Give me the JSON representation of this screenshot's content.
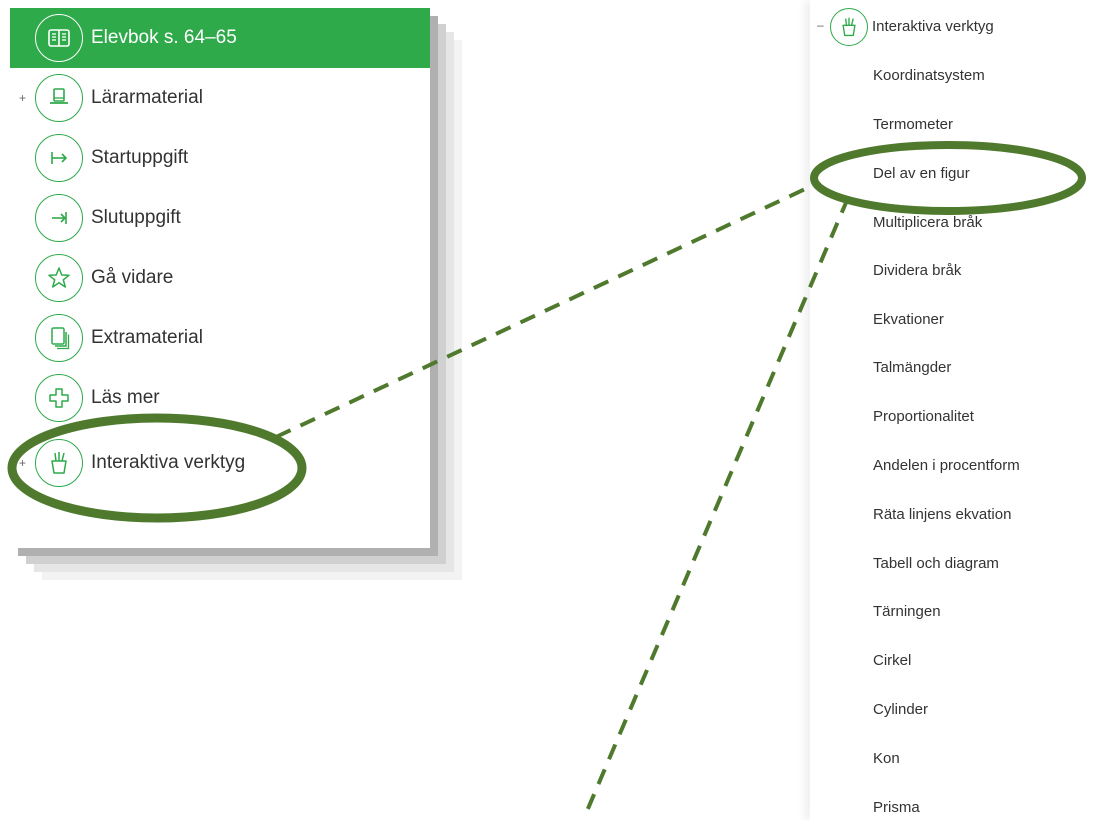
{
  "left_menu": {
    "items": [
      {
        "label": "Elevbok s. 64–65",
        "icon": "book-icon",
        "active": true,
        "expandable": false
      },
      {
        "label": "Lärarmaterial",
        "icon": "hat-icon",
        "active": false,
        "expandable": true
      },
      {
        "label": "Startuppgift",
        "icon": "arrow-start-icon",
        "active": false,
        "expandable": false
      },
      {
        "label": "Slutuppgift",
        "icon": "arrow-end-icon",
        "active": false,
        "expandable": false
      },
      {
        "label": "Gå vidare",
        "icon": "star-icon",
        "active": false,
        "expandable": false
      },
      {
        "label": "Extramaterial",
        "icon": "documents-icon",
        "active": false,
        "expandable": false
      },
      {
        "label": "Läs mer",
        "icon": "plus-cross-icon",
        "active": false,
        "expandable": false
      },
      {
        "label": "Interaktiva verktyg",
        "icon": "tools-cup-icon",
        "active": false,
        "expandable": true
      }
    ],
    "expand_symbol": "+"
  },
  "right_menu": {
    "collapse_symbol": "–",
    "title": "Interaktiva verktyg",
    "items": [
      "Koordinatsystem",
      "Termometer",
      "Del av en figur",
      "Multiplicera bråk",
      "Dividera bråk",
      "Ekvationer",
      "Talmängder",
      "Proportionalitet",
      "Andelen i procentform",
      "Räta linjens ekvation",
      "Tabell och diagram",
      "Tärningen",
      "Cirkel",
      "Cylinder",
      "Kon",
      "Prisma"
    ]
  },
  "colors": {
    "accent": "#2eaa4a",
    "annotation": "#4f7a2e"
  }
}
